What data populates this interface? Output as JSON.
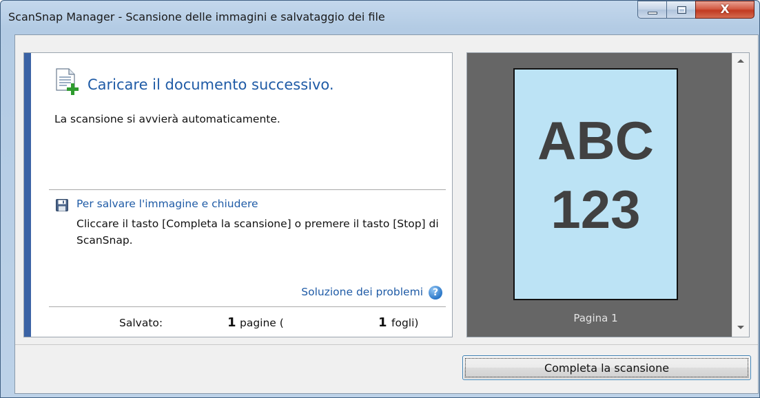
{
  "window": {
    "title": "ScanSnap Manager - Scansione delle immagini e salvataggio dei file",
    "controls": {
      "minimize": "minimize",
      "maximize": "maximize",
      "close": "X"
    }
  },
  "left_panel": {
    "heading": "Caricare il documento successivo.",
    "auto_text": "La scansione si avvierà automaticamente.",
    "save_link": "Per salvare l'immagine e chiudere",
    "save_desc": "Cliccare il tasto [Completa la scansione] o premere il tasto [Stop] di ScanSnap.",
    "help_link": "Soluzione dei problemi",
    "help_icon": "?",
    "status": {
      "label": "Salvato:",
      "pages_count": "1",
      "pages_word": "pagine (",
      "sheets_count": "1",
      "sheets_word": "fogli)"
    }
  },
  "preview": {
    "page_line1": "ABC",
    "page_line2": "123",
    "page_label": "Pagina 1"
  },
  "footer": {
    "complete_button": "Completa la scansione"
  },
  "colors": {
    "accent": "#3b63a5",
    "link": "#1f5ba6",
    "page": "#bce3f5",
    "preview_bg": "#666666"
  }
}
